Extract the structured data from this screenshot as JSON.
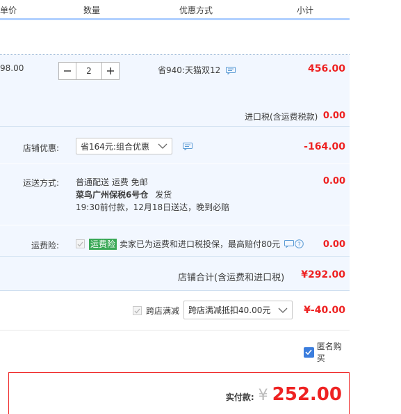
{
  "header": {
    "col_price": "单价",
    "col_qty": "数量",
    "col_discount": "优惠方式",
    "col_subtotal": "小计"
  },
  "item": {
    "unit_price": "98.00",
    "quantity": "2",
    "discount": "省940:天猫双12",
    "subtotal": "456.00"
  },
  "import_tax": {
    "label": "进口税(含运费税款)",
    "value": "0.00"
  },
  "shop_discount": {
    "label": "店铺优惠:",
    "selected": "省164元:组合优惠",
    "value": "-164.00"
  },
  "shipping": {
    "label": "运送方式:",
    "line1": "普通配送 运费 免邮",
    "line2_bold": "菜鸟广州保税6号仓",
    "line2_suffix": "发货",
    "line3": "19:30前付款，12月18日送达，晚到必赔",
    "value": "0.00"
  },
  "freight_insurance": {
    "label": "运费险:",
    "badge": "运费险",
    "text": "卖家已为运费和进口税投保，最高赔付80元",
    "value": "0.00"
  },
  "shop_total": {
    "label": "店铺合计(含运费和进口税)",
    "value": "¥292.00"
  },
  "cross_store": {
    "label": "跨店满减",
    "selected": "跨店满减抵扣40.00元",
    "value": "¥-40.00"
  },
  "anonymous": {
    "label": "匿名购买"
  },
  "payment": {
    "label": "实付款:",
    "currency": "¥",
    "amount": "252.00"
  },
  "colors": {
    "accent_red": "#ee2222",
    "highlight_blue": "#f2f7ff",
    "insurance_green": "#3aa856",
    "checkbox_blue": "#3b7ddd"
  }
}
